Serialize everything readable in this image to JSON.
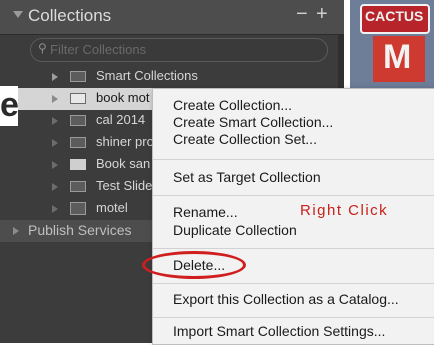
{
  "panel": {
    "title": "Collections",
    "minus_label": "−",
    "plus_label": "+",
    "filter_placeholder": "Filter Collections"
  },
  "collections": [
    {
      "label": "Smart Collections"
    },
    {
      "label": "book mot"
    },
    {
      "label": "cal 2014"
    },
    {
      "label": "shiner pro"
    },
    {
      "label": "Book san"
    },
    {
      "label": "Test Slide"
    },
    {
      "label": "motel"
    }
  ],
  "publish_services_label": "Publish Services",
  "edge_letter": "e",
  "thumbnail": {
    "sign_text": "CACTUS",
    "letter": "M"
  },
  "context_menu": {
    "items": [
      "Create Collection...",
      "Create Smart Collection...",
      "Create Collection Set...",
      "Set as Target Collection",
      "Rename...",
      "Duplicate Collection",
      "Delete...",
      "Export this Collection as a Catalog...",
      "Import Smart Collection Settings..."
    ]
  },
  "annotation": {
    "right_click": "Right Click",
    "highlight_color": "#d01e1e"
  },
  "colors": {
    "panel_bg": "#3c3c3c",
    "selected_row": "#d5d5d5",
    "menu_bg": "#f2f2f2"
  }
}
